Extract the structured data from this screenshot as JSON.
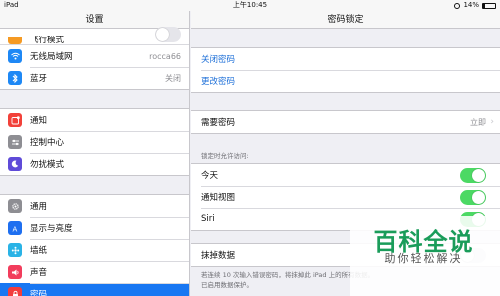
{
  "status_bar": {
    "device": "iPad",
    "time": "上午10:45",
    "battery": "14%"
  },
  "sidebar": {
    "title": "设置",
    "top_item": {
      "label": "飞行模式"
    },
    "items_group1": [
      {
        "label": "无线局域网",
        "value": "rocca66",
        "icon": "wifi-icon",
        "color": "#1e88f5"
      },
      {
        "label": "蓝牙",
        "value": "关闭",
        "icon": "bluetooth-icon",
        "color": "#1e88f5"
      }
    ],
    "items_group2": [
      {
        "label": "通知",
        "icon": "notification-icon",
        "color": "#f2413a"
      },
      {
        "label": "控制中心",
        "icon": "control-center-icon",
        "color": "#8e8e93"
      },
      {
        "label": "勿扰模式",
        "icon": "moon-icon",
        "color": "#5f4bd8"
      }
    ],
    "items_group3": [
      {
        "label": "通用",
        "icon": "gear-icon",
        "color": "#8e8e93"
      },
      {
        "label": "显示与亮度",
        "icon": "display-icon",
        "color": "#1e6ff0"
      },
      {
        "label": "墙纸",
        "icon": "wallpaper-icon",
        "color": "#2ab3e6"
      },
      {
        "label": "声音",
        "icon": "sound-icon",
        "color": "#f23d5c"
      },
      {
        "label": "密码",
        "icon": "lock-icon",
        "color": "#f23d3d"
      }
    ]
  },
  "main": {
    "title": "密码锁定",
    "passcode_actions": [
      "关闭密码",
      "更改密码"
    ],
    "require_passcode": {
      "label": "需要密码",
      "value": "立即"
    },
    "lock_access_header": "锁定时允许访问:",
    "lock_access_items": [
      {
        "label": "今天",
        "on": true
      },
      {
        "label": "通知视图",
        "on": true
      },
      {
        "label": "Siri",
        "on": true
      }
    ],
    "erase_data": {
      "label": "抹掉数据",
      "on": false
    },
    "footer_line1": "若连续 10 次输入错误密码，将抹掉此 iPad 上的所有数据。",
    "footer_line2": "已启用数据保护。"
  },
  "watermark": {
    "logo": "百科全说",
    "subtitle": "助你轻松解决"
  }
}
